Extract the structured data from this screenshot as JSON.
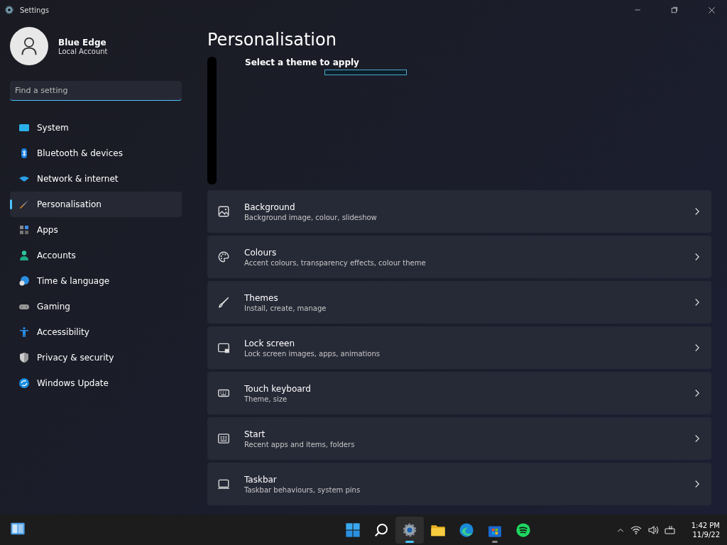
{
  "window": {
    "title": "Settings"
  },
  "account": {
    "name": "Blue Edge",
    "type": "Local Account"
  },
  "search": {
    "placeholder": "Find a setting"
  },
  "sidebar": {
    "items": [
      {
        "label": "System",
        "selected": false
      },
      {
        "label": "Bluetooth & devices",
        "selected": false
      },
      {
        "label": "Network & internet",
        "selected": false
      },
      {
        "label": "Personalisation",
        "selected": true
      },
      {
        "label": "Apps",
        "selected": false
      },
      {
        "label": "Accounts",
        "selected": false
      },
      {
        "label": "Time & language",
        "selected": false
      },
      {
        "label": "Gaming",
        "selected": false
      },
      {
        "label": "Accessibility",
        "selected": false
      },
      {
        "label": "Privacy & security",
        "selected": false
      },
      {
        "label": "Windows Update",
        "selected": false
      }
    ]
  },
  "page": {
    "title": "Personalisation",
    "theme_heading": "Select a theme to apply",
    "cards": [
      {
        "title": "Background",
        "subtitle": "Background image, colour, slideshow"
      },
      {
        "title": "Colours",
        "subtitle": "Accent colours, transparency effects, colour theme"
      },
      {
        "title": "Themes",
        "subtitle": "Install, create, manage"
      },
      {
        "title": "Lock screen",
        "subtitle": "Lock screen images, apps, animations"
      },
      {
        "title": "Touch keyboard",
        "subtitle": "Theme, size"
      },
      {
        "title": "Start",
        "subtitle": "Recent apps and items, folders"
      },
      {
        "title": "Taskbar",
        "subtitle": "Taskbar behaviours, system pins"
      }
    ]
  },
  "taskbar": {
    "apps": [
      {
        "selected": false,
        "running": false
      },
      {
        "selected": false,
        "running": false
      },
      {
        "selected": true,
        "running": true
      },
      {
        "selected": false,
        "running": false
      },
      {
        "selected": false,
        "running": false
      },
      {
        "selected": false,
        "running": true
      },
      {
        "selected": false,
        "running": false
      }
    ],
    "time": "1:42 PM",
    "date": "11/9/22"
  }
}
